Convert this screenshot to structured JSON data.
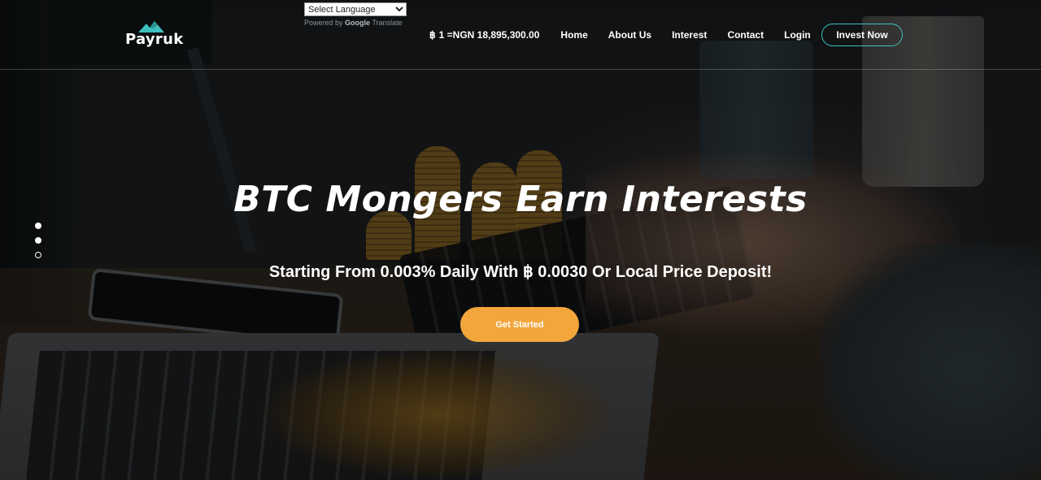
{
  "header": {
    "logo_text": "Payruk",
    "language_select": {
      "selected": "Select Language"
    },
    "powered_by": {
      "prefix": "Powered by",
      "brand": "Google",
      "suffix": "Translate"
    },
    "btc_price": "1 =NGN 18,895,300.00",
    "btc_symbol": "฿",
    "nav": {
      "home": "Home",
      "about": "About Us",
      "interest": "Interest",
      "contact": "Contact",
      "login": "Login"
    },
    "invest_button": "Invest Now"
  },
  "slider": {
    "dots": [
      {
        "active": true
      },
      {
        "active": true
      },
      {
        "active": false
      }
    ]
  },
  "hero": {
    "title": "BTC Mongers Earn Interests",
    "subtitle": "Starting From 0.003% Daily With ฿ 0.0030 Or Local Price Deposit!",
    "cta": "Get Started"
  },
  "colors": {
    "accent_orange": "#f2a63c",
    "invest_border": "#3fbfc0",
    "logo_mark": "#3fbfc0"
  }
}
